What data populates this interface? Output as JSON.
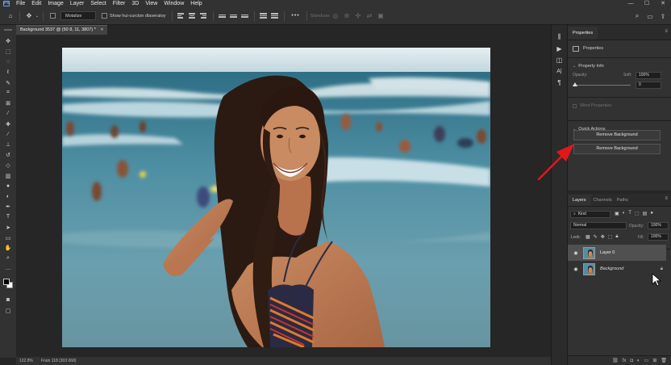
{
  "menu": {
    "logo": "Ps",
    "items": [
      "File",
      "Edit",
      "Image",
      "Layer",
      "Select",
      "Filter",
      "3D",
      "View",
      "Window",
      "Help"
    ]
  },
  "options_bar": {
    "move_icon": "move-tool-icon",
    "auto_select_value": "Motalize",
    "show_transform_label": "Show hui-curcton dlaveratoy",
    "more_label": "•••",
    "mode_label": "Standuws",
    "right_icons": [
      "search-icon",
      "workspace-icon",
      "share-icon"
    ]
  },
  "window_controls": [
    "—",
    "☐",
    "✕"
  ],
  "document": {
    "tab_label": "Background 3537 @ (50 8, 11, 3807) *",
    "tab_close": "×",
    "status_zoom": "122.8%",
    "status_doc": "Frain 118 (303 068)"
  },
  "tools": [
    "move",
    "artboard",
    "marquee",
    "lasso",
    "quick-select",
    "crop",
    "frame",
    "eyedropper",
    "healing",
    "brush",
    "stamp",
    "history-brush",
    "eraser",
    "gradient",
    "blur",
    "dodge",
    "pen",
    "type",
    "path-select",
    "rectangle",
    "hand",
    "zoom",
    "more"
  ],
  "dock_icons": [
    "arrange-icon",
    "play-icon",
    "history-icon",
    "character-icon",
    "paragraph-icon"
  ],
  "properties": {
    "tab_label": "Properties",
    "menu_icon": "≡",
    "subheader": "Properties",
    "property_info_label": "Property Info",
    "opacity_label": "Opacity:",
    "soft_label": "Soft:",
    "soft_value": "100%",
    "second_value": "0",
    "wind_properties_label": "Wind Properties",
    "quick_actions_label": "Quick Actions",
    "remove_bg_button_1": "Remove Background",
    "remove_bg_button_2": "Remove Background"
  },
  "layers_panel": {
    "tabs": [
      "Layers",
      "Channels",
      "Paths"
    ],
    "active_tab": "Layers",
    "filter_kind": "Kind",
    "blend_mode": "Normal",
    "opacity_label": "Opacity:",
    "opacity_value": "100%",
    "lock_label": "Lock:",
    "fill_label": "Fill:",
    "fill_value": "100%",
    "layers": [
      {
        "name": "Layer 0",
        "italic": false,
        "selected": true,
        "locked": false
      },
      {
        "name": "Background",
        "italic": true,
        "selected": false,
        "locked": true
      }
    ],
    "bottom_icons": [
      "link-icon",
      "fx-icon",
      "mask-icon",
      "adjustment-icon",
      "group-icon",
      "new-layer-icon",
      "delete-icon"
    ]
  },
  "colors": {
    "ui_dark": "#262626",
    "ui_panel": "#323232",
    "accent_arrow": "#e01818",
    "selected_layer": "#505050"
  }
}
